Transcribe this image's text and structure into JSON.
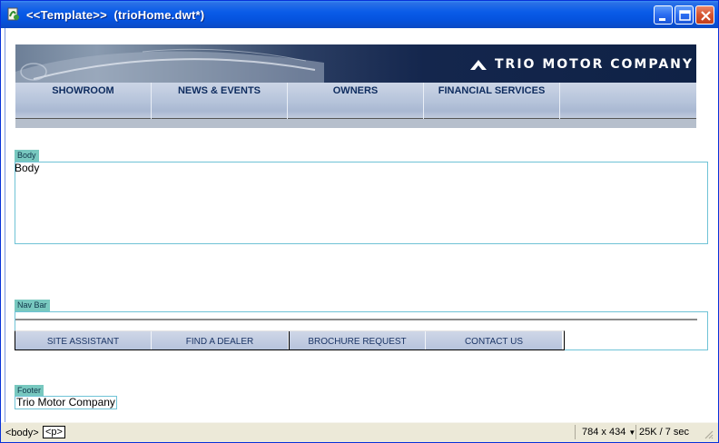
{
  "window": {
    "title": "<<Template>>  (trioHome.dwt*)",
    "icon": "dreamweaver-document-icon",
    "colors": {
      "titlebar": "#0a5ce8",
      "close": "#d5532f",
      "statusbar": "#ece9d8"
    }
  },
  "banner": {
    "brand": "TRIO MOTOR COMPANY",
    "logo": "trio-chevron-logo"
  },
  "main_nav": {
    "items": [
      {
        "label": "SHOWROOM"
      },
      {
        "label": "NEWS & EVENTS"
      },
      {
        "label": "OWNERS"
      },
      {
        "label": "FINANCIAL SERVICES"
      },
      {
        "label": ""
      }
    ]
  },
  "regions": {
    "body": {
      "tab": "Body",
      "content": "Body"
    },
    "navbar": {
      "tab": "Nav Bar"
    },
    "footer": {
      "tab": "Footer",
      "content": "Trio Motor Company"
    }
  },
  "sub_nav": {
    "items": [
      {
        "label": "SITE ASSISTANT"
      },
      {
        "label": "FIND A DEALER"
      },
      {
        "label": "BROCHURE REQUEST"
      },
      {
        "label": "CONTACT US"
      }
    ]
  },
  "status": {
    "tag_body": "<body>",
    "tag_p": "<p>",
    "window_size": "784 x 434",
    "download": "25K / 7 sec"
  }
}
